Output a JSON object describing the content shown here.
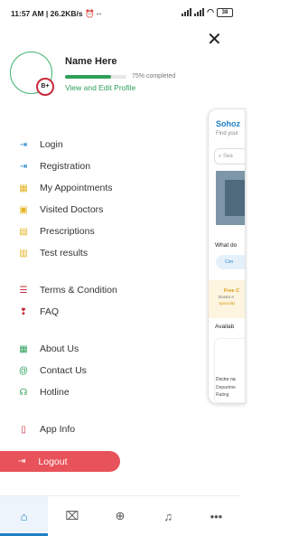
{
  "status_bar": {
    "time": "11:57 AM",
    "speed": "26.2KB/s",
    "battery": "38"
  },
  "profile": {
    "name": "Name Here",
    "blood_group": "B+",
    "progress_fraction": 0.75,
    "progress_text": "75% completed",
    "edit_link": "View and Edit Profile"
  },
  "menu": {
    "login": "Login",
    "registration": "Registration",
    "appointments": "My Appointments",
    "visited": "Visited Doctors",
    "prescriptions": "Prescriptions",
    "tests": "Test results",
    "terms": "Terms & Condition",
    "faq": "FAQ",
    "about": "About Us",
    "contact": "Contact Us",
    "hotline": "Hotline",
    "appinfo": "App Info"
  },
  "logout_label": "Logout",
  "peek": {
    "title": "Sohoz",
    "subtitle": "Find your",
    "search": "Sea",
    "section1": "What do",
    "pill": "Con",
    "promo1": "Free C",
    "promo2": "Doctor n",
    "promo3": "Specialty",
    "section2": "Availab",
    "doc1": "Doctor na",
    "doc2": "Departme",
    "doc3": "Rating"
  },
  "colors": {
    "accent": "#1d80c7",
    "green": "#2fa05a",
    "logout": "#e8525b"
  },
  "nav_icons": [
    "home-icon",
    "hospital-icon",
    "add-location-icon",
    "bell-icon",
    "more-icon"
  ]
}
